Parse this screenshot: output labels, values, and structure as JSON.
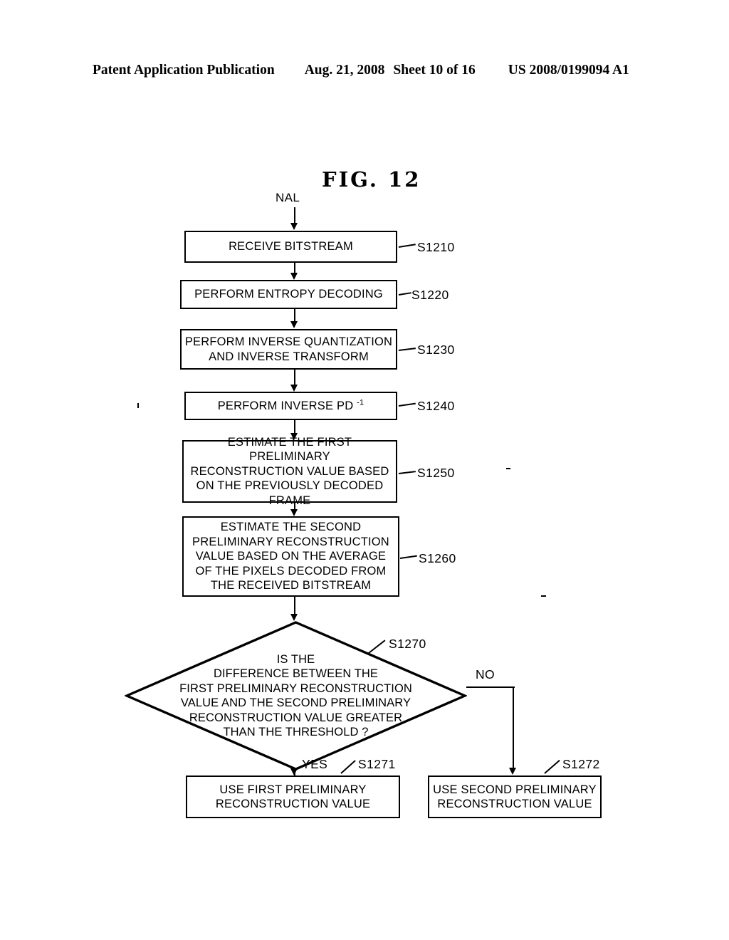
{
  "header": {
    "publication": "Patent Application Publication",
    "date": "Aug. 21, 2008",
    "sheet": "Sheet 10 of 16",
    "patent_number": "US 2008/0199094 A1"
  },
  "figure": {
    "title": "FIG. 12",
    "entry_label": "NAL"
  },
  "flow": {
    "steps": [
      {
        "id": "S1210",
        "text": "RECEIVE BITSTREAM",
        "ref": "S1210"
      },
      {
        "id": "S1220",
        "text": "PERFORM ENTROPY DECODING",
        "ref": "S1220"
      },
      {
        "id": "S1230",
        "text": "PERFORM INVERSE QUANTIZATION\nAND INVERSE TRANSFORM",
        "ref": "S1230"
      },
      {
        "id": "S1240",
        "text_before_sup": "PERFORM INVERSE PD ",
        "superscript": "-1",
        "ref": "S1240"
      },
      {
        "id": "S1250",
        "text": "ESTIMATE THE FIRST PRELIMINARY\nRECONSTRUCTION VALUE BASED\nON THE PREVIOUSLY DECODED\nFRAME",
        "ref": "S1250"
      },
      {
        "id": "S1260",
        "text": "ESTIMATE THE SECOND\nPRELIMINARY RECONSTRUCTION\nVALUE BASED ON THE AVERAGE\nOF THE PIXELS DECODED FROM\nTHE RECEIVED BITSTREAM",
        "ref": "S1260"
      }
    ],
    "decision": {
      "id": "S1270",
      "text": "IS THE\nDIFFERENCE BETWEEN THE\nFIRST PRELIMINARY RECONSTRUCTION\nVALUE AND THE SECOND PRELIMINARY\nRECONSTRUCTION VALUE GREATER\nTHAN THE THRESHOLD ?",
      "ref": "S1270",
      "yes_label": "YES",
      "no_label": "NO"
    },
    "outcomes": [
      {
        "id": "S1271",
        "text": "USE FIRST PRELIMINARY\nRECONSTRUCTION VALUE",
        "ref": "S1271"
      },
      {
        "id": "S1272",
        "text": "USE SECOND PRELIMINARY\nRECONSTRUCTION VALUE",
        "ref": "S1272"
      }
    ]
  },
  "colors": {
    "ink": "#000000",
    "paper": "#ffffff"
  }
}
